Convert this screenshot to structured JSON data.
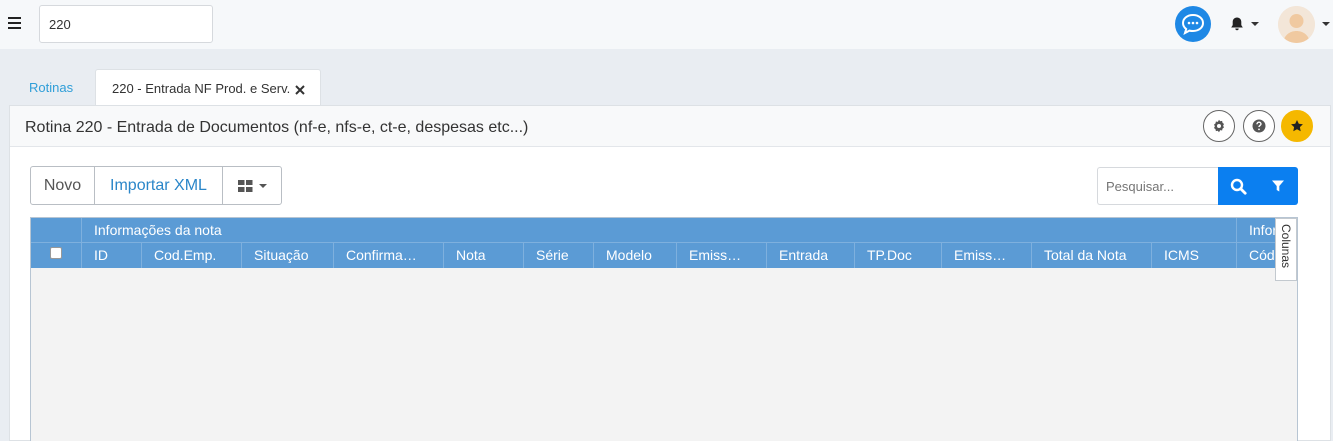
{
  "topbar": {
    "routine_input_value": "220",
    "menu_icon": "hamburger-icon",
    "chat_icon": "chat-bubble-icon",
    "bell_icon": "bell-icon",
    "brand_blue": "#1e88e5"
  },
  "tabs": {
    "rotinas_label": "Rotinas",
    "active_label": "220 - Entrada NF Prod. e Serv."
  },
  "panel": {
    "title": "Rotina 220 - Entrada de Documentos (nf-e, nfs-e, ct-e, despesas etc...)",
    "settings_icon": "gear-icon",
    "help_icon": "question-icon",
    "favorite_icon": "star-icon",
    "favorite_color": "#f5b800"
  },
  "toolbar": {
    "novo_label": "Novo",
    "importar_label": "Importar XML",
    "layout_icon": "grid-view-icon",
    "search_placeholder": "Pesquisar...",
    "search_icon": "search-icon",
    "filter_icon": "filter-icon",
    "search_color": "#0b7ff0"
  },
  "grid": {
    "header_color": "#5b9bd5",
    "group_headers": [
      "Informações da nota",
      "Infor"
    ],
    "columns": [
      "ID",
      "Cod.Emp.",
      "Situação",
      "Confirma…",
      "Nota",
      "Série",
      "Modelo",
      "Emiss…",
      "Entrada",
      "TP.Doc",
      "Emiss…",
      "Total da Nota",
      "ICMS",
      "Cód"
    ],
    "colunas_label": "Colunas"
  }
}
